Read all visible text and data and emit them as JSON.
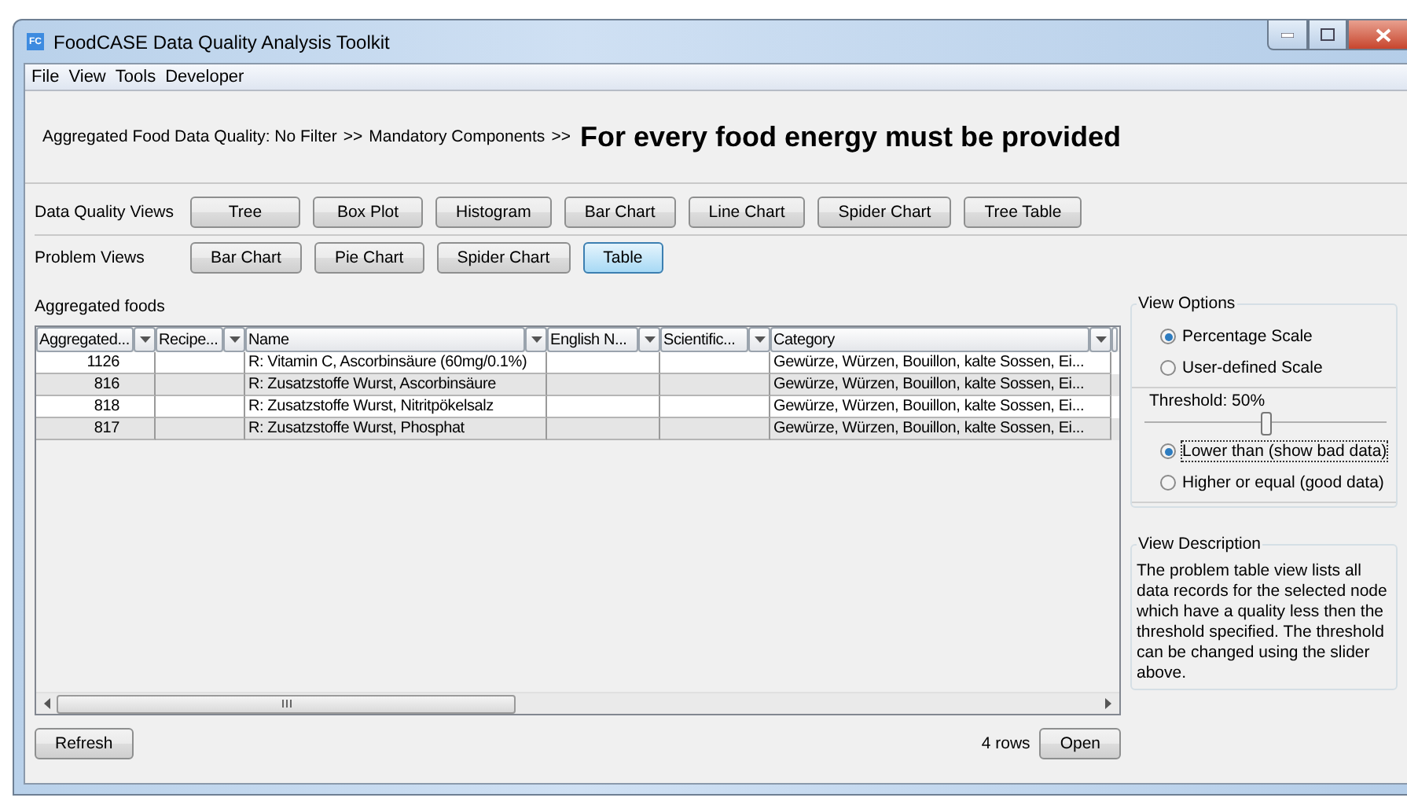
{
  "window": {
    "title": "FoodCASE Data Quality Analysis Toolkit",
    "app_icon": "FC"
  },
  "menu": [
    "File",
    "View",
    "Tools",
    "Developer"
  ],
  "breadcrumb": {
    "path": [
      {
        "label": "Aggregated Food Data Quality: No Filter",
        "separator": ">>"
      },
      {
        "label": "Mandatory Components",
        "separator": ">>"
      }
    ],
    "heading": "For every food energy must be provided"
  },
  "view_groups": [
    {
      "label": "Data Quality Views",
      "buttons": [
        {
          "label": "Tree",
          "selected": false
        },
        {
          "label": "Box Plot",
          "selected": false
        },
        {
          "label": "Histogram",
          "selected": false
        },
        {
          "label": "Bar Chart",
          "selected": false
        },
        {
          "label": "Line Chart",
          "selected": false
        },
        {
          "label": "Spider Chart",
          "selected": false
        },
        {
          "label": "Tree Table",
          "selected": false
        }
      ]
    },
    {
      "label": "Problem Views",
      "buttons": [
        {
          "label": "Bar Chart",
          "selected": false
        },
        {
          "label": "Pie Chart",
          "selected": false
        },
        {
          "label": "Spider Chart",
          "selected": false
        },
        {
          "label": "Table",
          "selected": true
        }
      ]
    }
  ],
  "table": {
    "title": "Aggregated foods",
    "columns": [
      {
        "label": "Aggregated..."
      },
      {
        "label": "Recipe..."
      },
      {
        "label": "Name"
      },
      {
        "label": "English N..."
      },
      {
        "label": "Scientific..."
      },
      {
        "label": "Category"
      }
    ],
    "rows": [
      {
        "cells": [
          "1126",
          "",
          "R: Vitamin C, Ascorbinsäure (60mg/0.1%)",
          "",
          "",
          "Gewürze, Würzen, Bouillon, kalte Sossen, Ei..."
        ]
      },
      {
        "cells": [
          "816",
          "",
          "R: Zusatzstoffe Wurst, Ascorbinsäure",
          "",
          "",
          "Gewürze, Würzen, Bouillon, kalte Sossen, Ei..."
        ]
      },
      {
        "cells": [
          "818",
          "",
          "R: Zusatzstoffe Wurst, Nitritpökelsalz",
          "",
          "",
          "Gewürze, Würzen, Bouillon, kalte Sossen, Ei..."
        ]
      },
      {
        "cells": [
          "817",
          "",
          "R: Zusatzstoffe Wurst, Phosphat",
          "",
          "",
          "Gewürze, Würzen, Bouillon, kalte Sossen, Ei..."
        ]
      }
    ],
    "row_count": "4 rows"
  },
  "footer": {
    "refresh": "Refresh",
    "open": "Open"
  },
  "view_options": {
    "title": "View Options",
    "scales": [
      {
        "label": "Percentage Scale",
        "selected": true
      },
      {
        "label": "User-defined Scale",
        "selected": false
      }
    ],
    "threshold": {
      "label": "Threshold: 50%",
      "level": 0.5
    },
    "filters": [
      {
        "label": "Lower than (show bad data)",
        "selected": true,
        "focused": true
      },
      {
        "label": "Higher or equal (good data)",
        "selected": false,
        "focused": false
      }
    ]
  },
  "view_description": {
    "title": "View Description",
    "text": "The problem table view lists all data records for the selected node which have a quality less then the threshold specified. The threshold can be changed using the slider above."
  }
}
